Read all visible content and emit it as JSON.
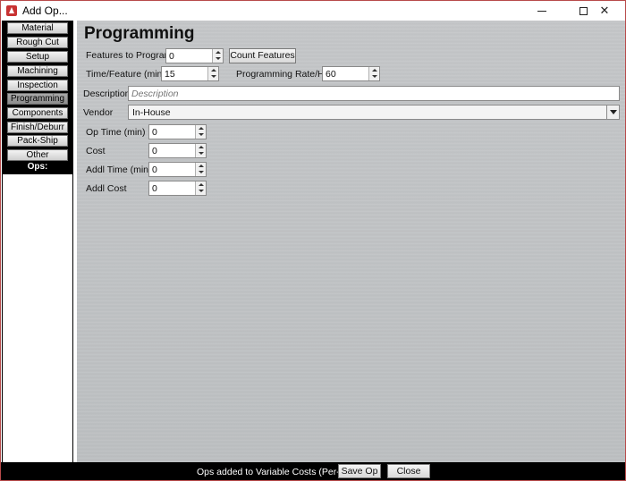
{
  "window": {
    "title": "Add Op...",
    "controls": {
      "minimize": "—",
      "maximize": "☐",
      "close": "✕"
    }
  },
  "sidebar": {
    "items": [
      {
        "label": "Material"
      },
      {
        "label": "Rough Cut"
      },
      {
        "label": "Setup"
      },
      {
        "label": "Machining"
      },
      {
        "label": "Inspection"
      },
      {
        "label": "Programming",
        "active": true
      },
      {
        "label": "Components"
      },
      {
        "label": "Finish/Deburr"
      },
      {
        "label": "Pack-Ship"
      },
      {
        "label": "Other"
      }
    ],
    "ops_label": "Ops:"
  },
  "main": {
    "title": "Programming",
    "features_label": "Features to Program",
    "features_value": "0",
    "count_features_button": "Count Features",
    "time_feature_label": "Time/Feature (min)",
    "time_feature_value": "15",
    "programming_rate_label": "Programming Rate/Hr",
    "programming_rate_value": "60",
    "description_label": "Description",
    "description_placeholder": "Description",
    "vendor_label": "Vendor",
    "vendor_value": "In-House",
    "op_time_label": "Op Time (min)",
    "op_time_value": "0",
    "cost_label": "Cost",
    "cost_value": "0",
    "addl_time_label": "Addl Time (min)",
    "addl_time_value": "0",
    "addl_cost_label": "Addl Cost",
    "addl_cost_value": "0"
  },
  "footer": {
    "status": "Ops added to Variable Costs (Per-Part)",
    "save_button": "Save Op",
    "close_button": "Close"
  }
}
